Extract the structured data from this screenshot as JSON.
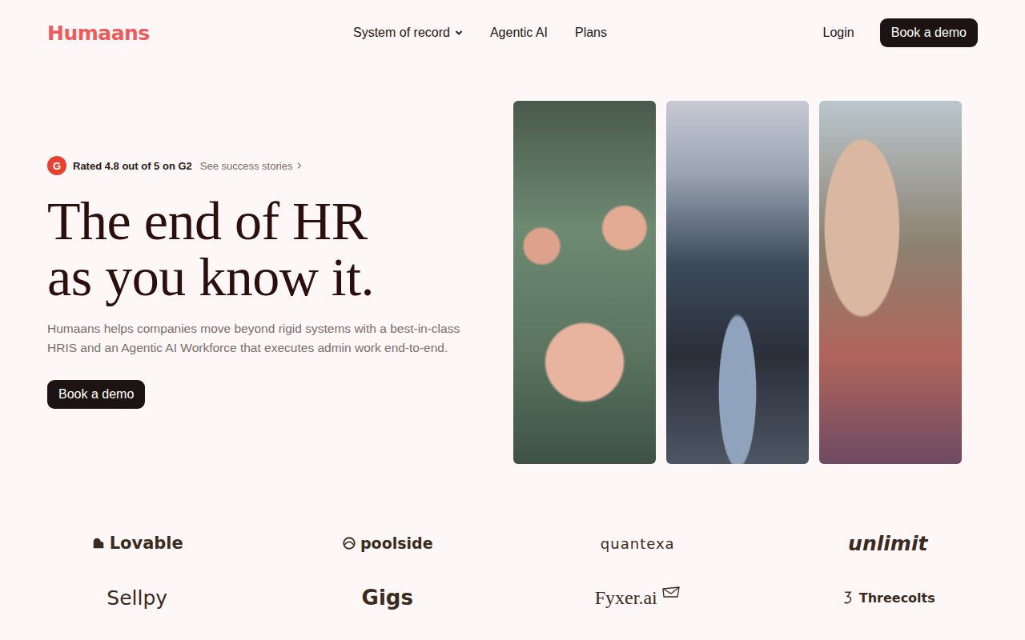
{
  "header": {
    "logo": "Humaans",
    "nav": [
      {
        "label": "System of record",
        "dropdown": true
      },
      {
        "label": "Agentic AI",
        "dropdown": false
      },
      {
        "label": "Plans",
        "dropdown": false
      }
    ],
    "login": "Login",
    "cta": "Book a demo"
  },
  "hero": {
    "badge": {
      "icon": "G",
      "rating": "Rated 4.8 out of 5 on G2",
      "link": "See success stories"
    },
    "headline": [
      "The end of HR",
      "as you know it."
    ],
    "subtitle": "Humaans helps companies move beyond rigid systems with a best-in-class HRIS and an Agentic AI Workforce that executes admin work end-to-end.",
    "cta": "Book a demo"
  },
  "logos": [
    {
      "name": "Lovable",
      "kind": "heart"
    },
    {
      "name": "poolside",
      "kind": "ring"
    },
    {
      "name": "quantexa",
      "kind": "plain"
    },
    {
      "name": "unlimit",
      "kind": "plain"
    },
    {
      "name": "Sellpy",
      "kind": "plain"
    },
    {
      "name": "Gigs",
      "kind": "plain"
    },
    {
      "name": "Fyxer.ai",
      "kind": "mail"
    },
    {
      "name": "Threecolts",
      "kind": "three"
    }
  ]
}
